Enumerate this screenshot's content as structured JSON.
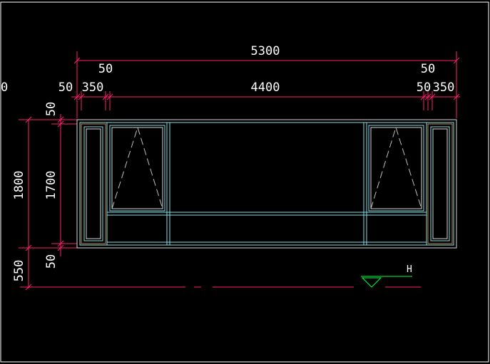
{
  "colors": {
    "background": "#000000",
    "viewport_border": "#ffffff",
    "dimension_line": "#ff1f6e",
    "text": "#ffffff",
    "frame_outer": "#d9d9d9",
    "frame_inner": "#7fe0e6",
    "fixed_panel": "#c8854a",
    "opening_indicator": "#c0c0c0",
    "level_marker": "#00ff3c"
  },
  "dimensions": {
    "top_overall": "5300",
    "top_left_frame": "50",
    "top_right_frame": "50",
    "left_frame_start": "50",
    "left_panel": "350",
    "middle_span": "4400",
    "right_frame_end": "50",
    "right_panel": "350",
    "left_cut_off": "0",
    "height_overall": "1800",
    "height_inner": "1700",
    "height_top_frame": "50",
    "height_bottom_frame": "50",
    "sill_height": "550"
  },
  "level_marker": {
    "label": "H"
  }
}
